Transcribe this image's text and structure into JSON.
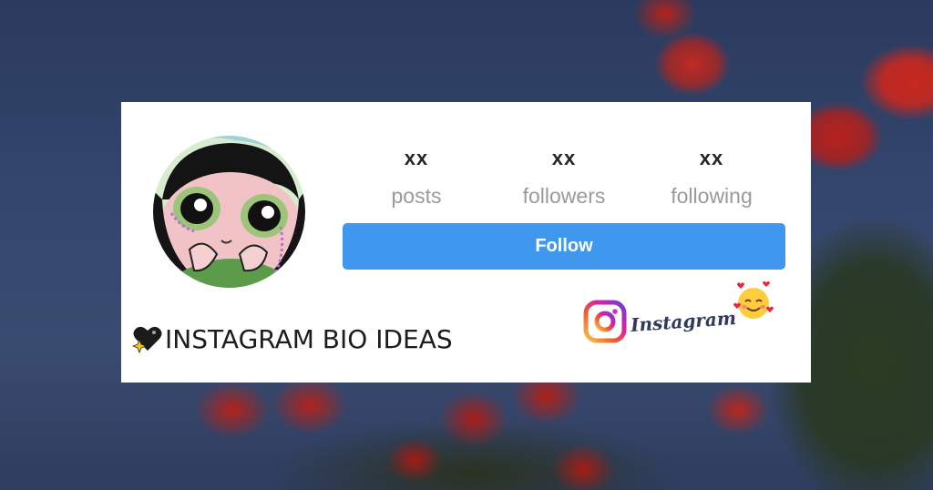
{
  "profile": {
    "stats": [
      {
        "value": "xx",
        "label": "posts"
      },
      {
        "value": "xx",
        "label": "followers"
      },
      {
        "value": "xx",
        "label": "following"
      }
    ],
    "follow_label": "Follow"
  },
  "bio": {
    "title": "INSTAGRAM BIO IDEAS",
    "icon": "black-sparkle-heart-icon"
  },
  "brand": {
    "wordmark": "Instagram",
    "icon": "instagram-logo-icon",
    "emoji": "smiling-face-with-hearts-icon"
  },
  "colors": {
    "follow_button": "#3f97ee",
    "card_background": "#ffffff",
    "stat_label": "#9a9a9a",
    "sky_background": "#2d3e63"
  }
}
